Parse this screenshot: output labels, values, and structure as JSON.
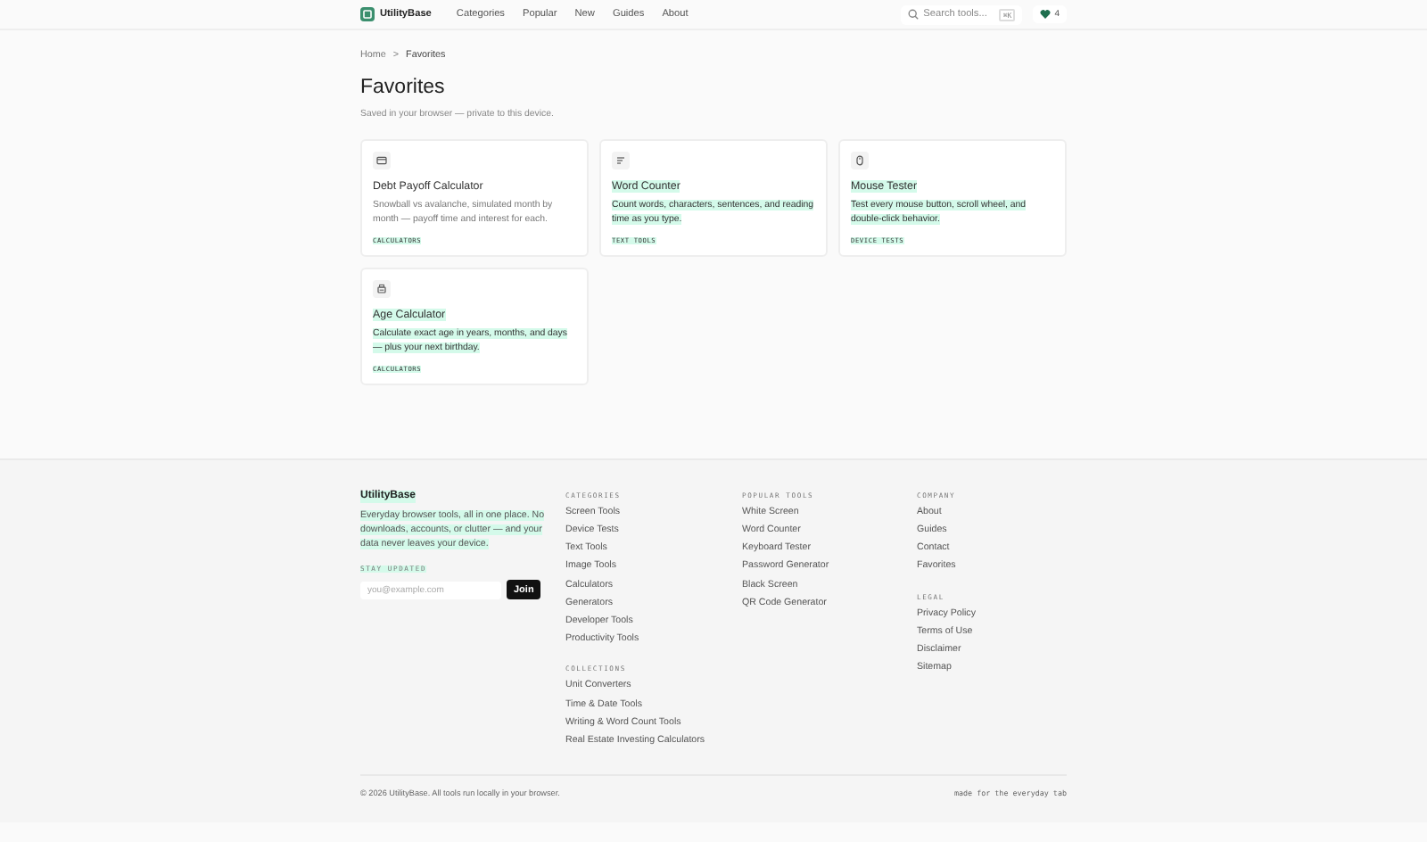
{
  "header": {
    "logo": "UtilityBase",
    "nav": [
      {
        "label": "Categories"
      },
      {
        "label": "Popular"
      },
      {
        "label": "New"
      },
      {
        "label": "Guides"
      },
      {
        "label": "About"
      }
    ],
    "search": {
      "placeholder": "Search tools...",
      "shortcut": "⌘K"
    },
    "favorites_count": "4"
  },
  "breadcrumb": {
    "items": [
      "Home",
      "Favorites"
    ],
    "separator": ">"
  },
  "page": {
    "title": "Favorites",
    "subtitle": "Saved in your browser — private to this device."
  },
  "cards": [
    {
      "title": "Debt Payoff Calculator",
      "description": "Snowball vs avalanche, simulated month by month — payoff time and interest for each.",
      "tag": "CALCULATORS",
      "highlighted": false
    },
    {
      "title": "Word Counter",
      "description": "Count words, characters, sentences, and reading time as you type.",
      "tag": "TEXT TOOLS",
      "highlighted": true
    },
    {
      "title": "Mouse Tester",
      "description": "Test every mouse button, scroll wheel, and double-click behavior.",
      "tag": "DEVICE TESTS",
      "highlighted": true
    },
    {
      "title": "Age Calculator",
      "description": "Calculate exact age in years, months, and days — plus your next birthday.",
      "tag": "CALCULATORS",
      "highlighted": true
    }
  ],
  "footer": {
    "brand": "UtilityBase",
    "tagline": "Everyday browser tools, all in one place. No downloads, accounts, or clutter — and your data never leaves your device.",
    "highlighted": true,
    "newsletter": {
      "label": "STAY UPDATED",
      "placeholder": "you@example.com",
      "button": "Join"
    },
    "columns": [
      [
        {
          "heading": "CATEGORIES",
          "links": [
            "Screen Tools",
            "Device Tests",
            "Text Tools",
            "Image Tools",
            "Calculators",
            "Generators",
            "Developer Tools",
            "Productivity Tools"
          ]
        },
        {
          "heading": "COLLECTIONS",
          "links": [
            "Unit Converters",
            "Time & Date Tools",
            "Writing & Word Count Tools",
            "Real Estate Investing Calculators"
          ]
        }
      ],
      [
        {
          "heading": "POPULAR TOOLS",
          "links": [
            "White Screen",
            "Word Counter",
            "Keyboard Tester",
            "Password Generator",
            "Black Screen",
            "QR Code Generator"
          ]
        }
      ],
      [
        {
          "heading": "COMPANY",
          "links": [
            "About",
            "Guides",
            "Contact",
            "Favorites"
          ]
        },
        {
          "heading": "LEGAL",
          "links": [
            "Privacy Policy",
            "Terms of Use",
            "Disclaimer",
            "Sitemap"
          ]
        }
      ]
    ],
    "copyright": "© 2026 UtilityBase. All tools run locally in your browser.",
    "motto": "made for the everyday tab"
  }
}
